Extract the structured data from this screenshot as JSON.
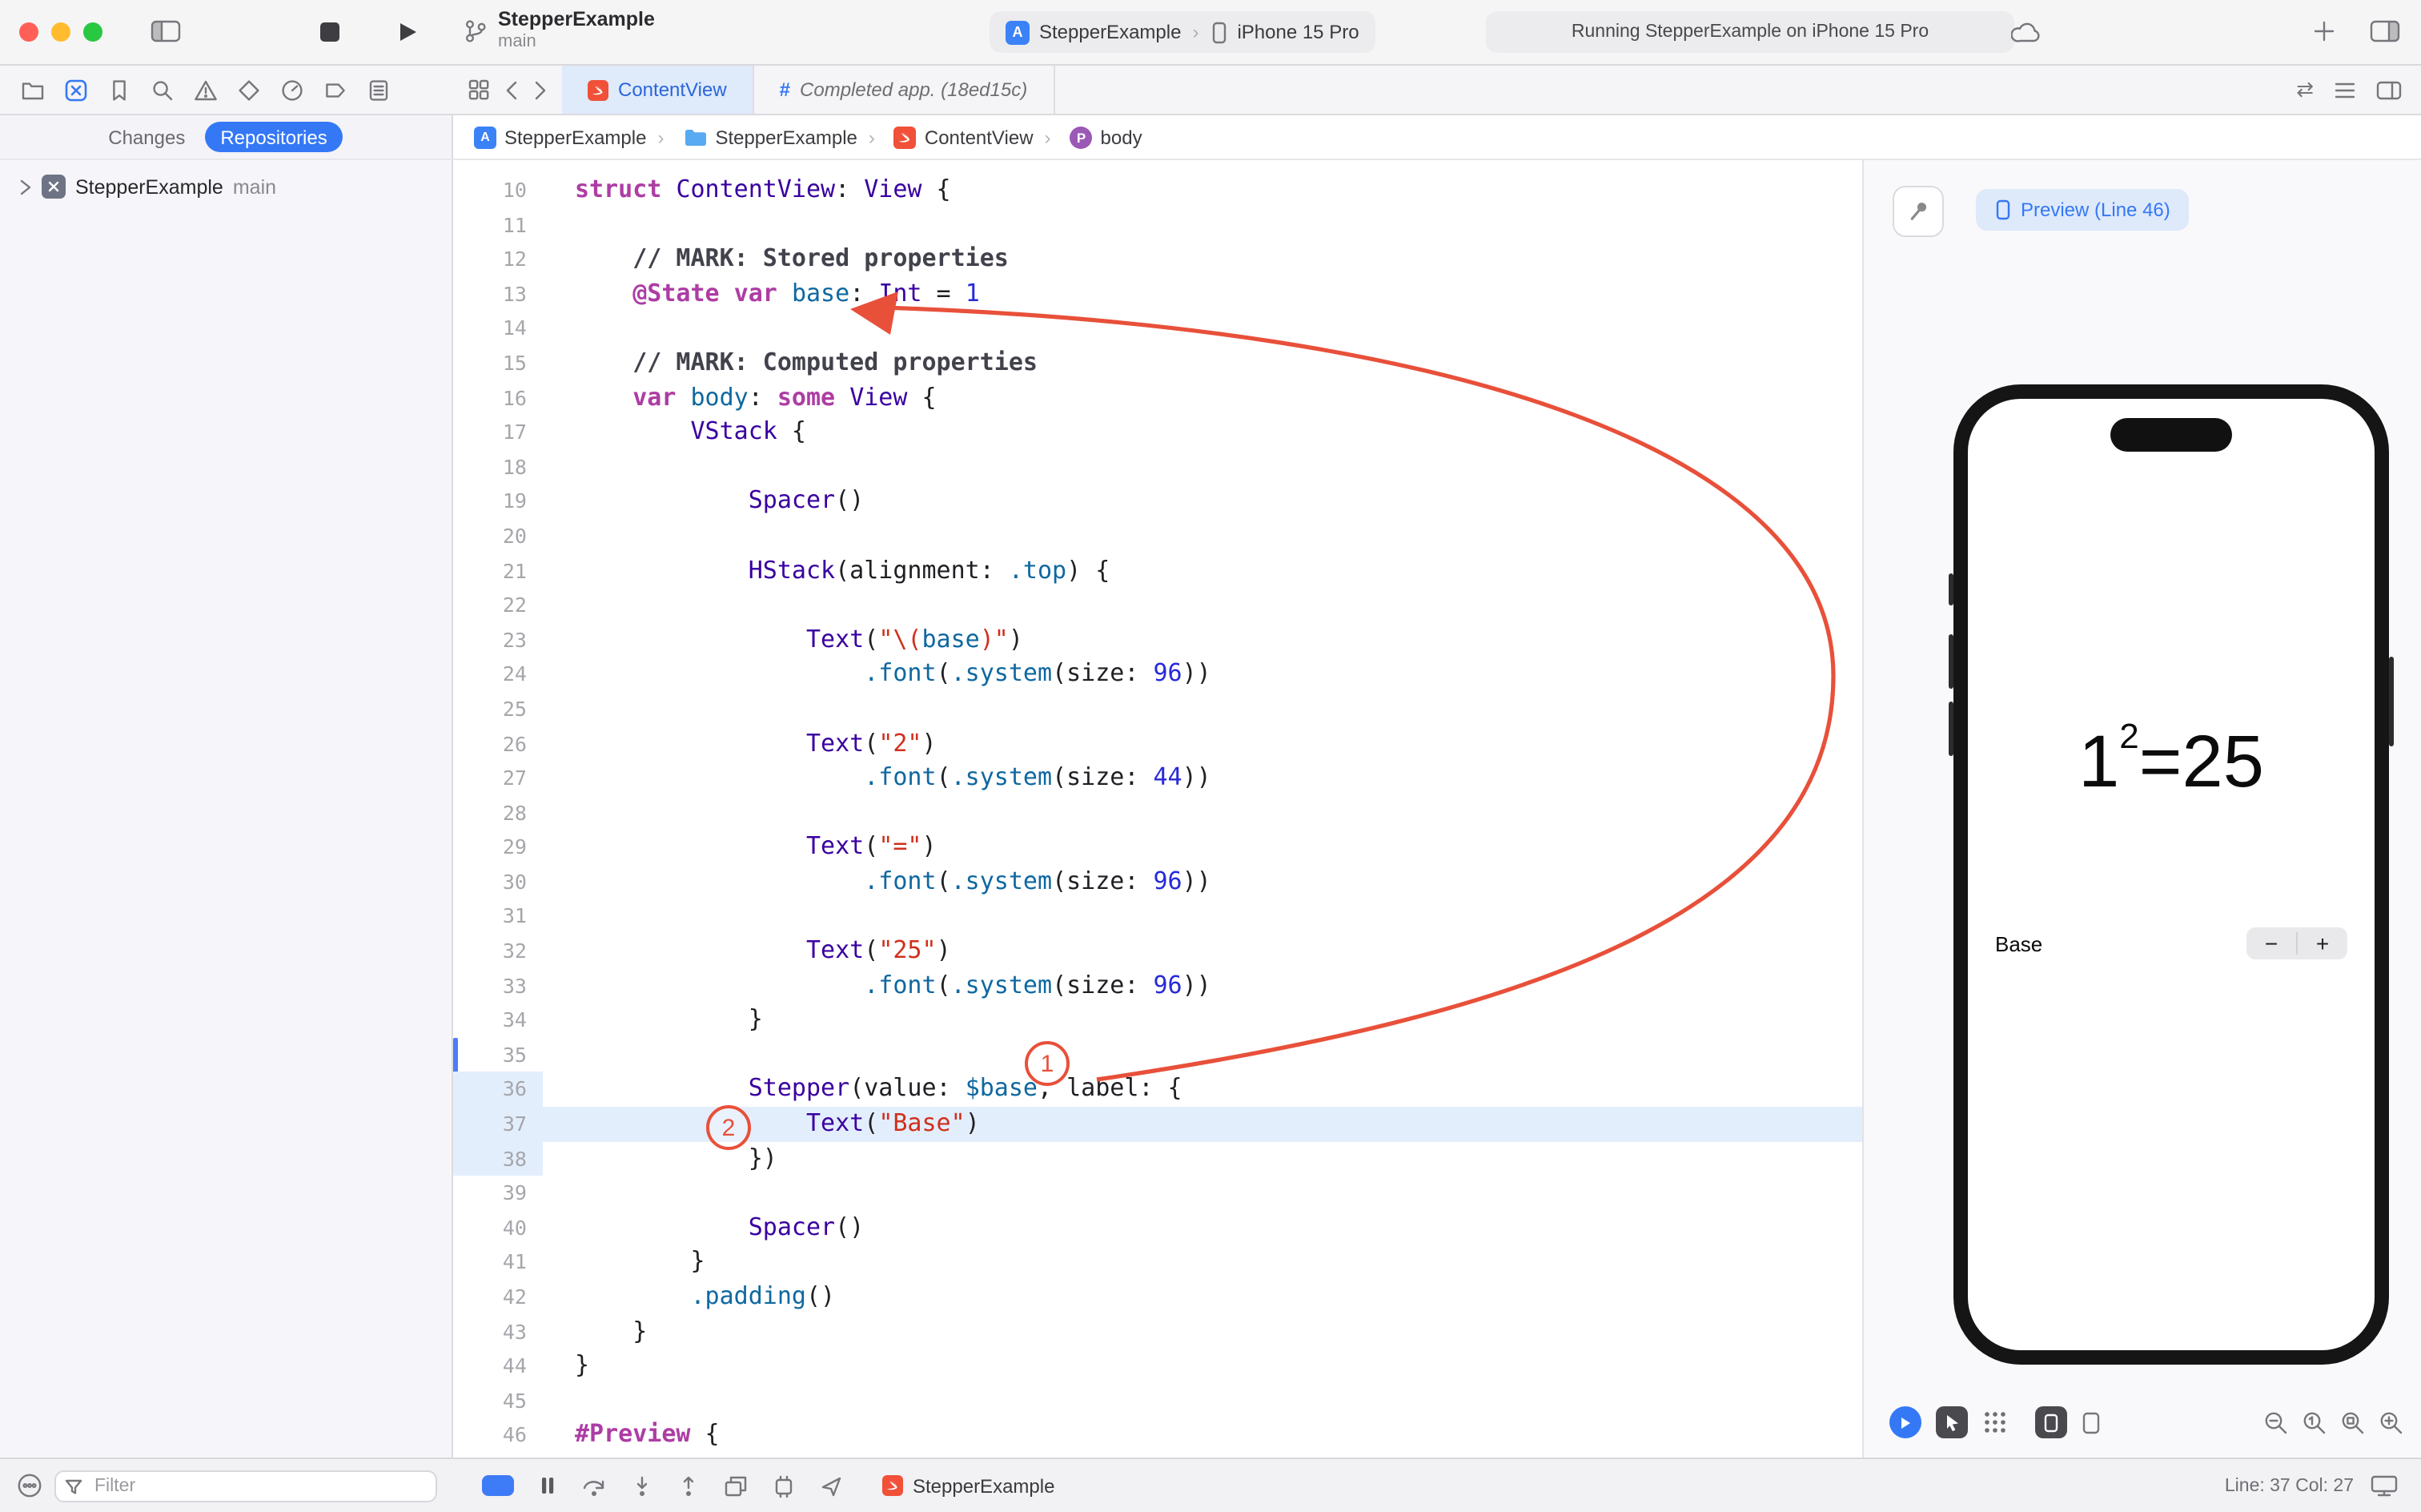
{
  "colors": {
    "accent": "#3478F6",
    "annotation_red": "#E8503A",
    "tab_active_bg": "#DFEAFB",
    "traffic_red": "#FF5F57",
    "traffic_yellow": "#FEBC2E",
    "traffic_green": "#28C840",
    "syntax_keyword": "#AD3DA4",
    "syntax_type": "#3900A0",
    "syntax_member": "#0F68A0",
    "syntax_string": "#D12F1B",
    "syntax_number": "#272AD8",
    "current_line_bg": "#E3EEFD",
    "change_bar": "#4D7DF7"
  },
  "titlebar": {
    "project": "StepperExample",
    "branch": "main",
    "scheme": "StepperExample",
    "device": "iPhone 15 Pro",
    "status": "Running StepperExample on iPhone 15 Pro"
  },
  "tabbar": {
    "tabs": [
      {
        "label": "ContentView",
        "active": true
      },
      {
        "prefix": "#",
        "label": "Completed app. (18ed15c)",
        "active": false
      }
    ]
  },
  "breadcrumb": {
    "items": [
      "StepperExample",
      "StepperExample",
      "ContentView",
      "body"
    ]
  },
  "sidebar": {
    "tabs": [
      "Changes",
      "Repositories"
    ],
    "active_tab": "Repositories",
    "items": [
      {
        "label": "StepperExample",
        "branch": "main"
      }
    ],
    "filter_placeholder": "Filter"
  },
  "editor": {
    "first_line": 10,
    "current_line": 37,
    "gutter_highlight": [
      36,
      37,
      38
    ],
    "changed_lines": [
      35,
      36,
      37,
      38
    ],
    "lines": [
      {
        "n": 10,
        "indent": 0,
        "tokens": [
          [
            "k",
            "struct"
          ],
          [
            "p",
            " "
          ],
          [
            "t",
            "ContentView"
          ],
          [
            "p",
            ": "
          ],
          [
            "t",
            "View"
          ],
          [
            "p",
            " {"
          ]
        ]
      },
      {
        "n": 11,
        "indent": 0,
        "tokens": []
      },
      {
        "n": 12,
        "indent": 4,
        "tokens": [
          [
            "c",
            "// MARK: Stored properties"
          ]
        ]
      },
      {
        "n": 13,
        "indent": 4,
        "tokens": [
          [
            "k",
            "@State"
          ],
          [
            "p",
            " "
          ],
          [
            "k",
            "var"
          ],
          [
            "p",
            " "
          ],
          [
            "m",
            "base"
          ],
          [
            "p",
            ": "
          ],
          [
            "t",
            "Int"
          ],
          [
            "p",
            " = "
          ],
          [
            "n",
            "1"
          ]
        ]
      },
      {
        "n": 14,
        "indent": 0,
        "tokens": []
      },
      {
        "n": 15,
        "indent": 4,
        "tokens": [
          [
            "c",
            "// MARK: Computed properties"
          ]
        ]
      },
      {
        "n": 16,
        "indent": 4,
        "tokens": [
          [
            "k",
            "var"
          ],
          [
            "p",
            " "
          ],
          [
            "m",
            "body"
          ],
          [
            "p",
            ": "
          ],
          [
            "k",
            "some"
          ],
          [
            "p",
            " "
          ],
          [
            "t",
            "View"
          ],
          [
            "p",
            " {"
          ]
        ]
      },
      {
        "n": 17,
        "indent": 8,
        "tokens": [
          [
            "t",
            "VStack"
          ],
          [
            "p",
            " {"
          ]
        ]
      },
      {
        "n": 18,
        "indent": 0,
        "tokens": []
      },
      {
        "n": 19,
        "indent": 12,
        "tokens": [
          [
            "t",
            "Spacer"
          ],
          [
            "p",
            "()"
          ]
        ]
      },
      {
        "n": 20,
        "indent": 0,
        "tokens": []
      },
      {
        "n": 21,
        "indent": 12,
        "tokens": [
          [
            "t",
            "HStack"
          ],
          [
            "p",
            "(alignment: "
          ],
          [
            "m",
            ".top"
          ],
          [
            "p",
            ") {"
          ]
        ]
      },
      {
        "n": 22,
        "indent": 0,
        "tokens": []
      },
      {
        "n": 23,
        "indent": 16,
        "tokens": [
          [
            "t",
            "Text"
          ],
          [
            "p",
            "("
          ],
          [
            "s",
            "\"\\("
          ],
          [
            "m",
            "base"
          ],
          [
            "s",
            ")\""
          ],
          [
            "p",
            ")"
          ]
        ]
      },
      {
        "n": 24,
        "indent": 20,
        "tokens": [
          [
            "m",
            ".font"
          ],
          [
            "p",
            "("
          ],
          [
            "m",
            ".system"
          ],
          [
            "p",
            "(size: "
          ],
          [
            "n",
            "96"
          ],
          [
            "p",
            "))"
          ]
        ]
      },
      {
        "n": 25,
        "indent": 0,
        "tokens": []
      },
      {
        "n": 26,
        "indent": 16,
        "tokens": [
          [
            "t",
            "Text"
          ],
          [
            "p",
            "("
          ],
          [
            "s",
            "\"2\""
          ],
          [
            "p",
            ")"
          ]
        ]
      },
      {
        "n": 27,
        "indent": 20,
        "tokens": [
          [
            "m",
            ".font"
          ],
          [
            "p",
            "("
          ],
          [
            "m",
            ".system"
          ],
          [
            "p",
            "(size: "
          ],
          [
            "n",
            "44"
          ],
          [
            "p",
            "))"
          ]
        ]
      },
      {
        "n": 28,
        "indent": 0,
        "tokens": []
      },
      {
        "n": 29,
        "indent": 16,
        "tokens": [
          [
            "t",
            "Text"
          ],
          [
            "p",
            "("
          ],
          [
            "s",
            "\"=\""
          ],
          [
            "p",
            ")"
          ]
        ]
      },
      {
        "n": 30,
        "indent": 20,
        "tokens": [
          [
            "m",
            ".font"
          ],
          [
            "p",
            "("
          ],
          [
            "m",
            ".system"
          ],
          [
            "p",
            "(size: "
          ],
          [
            "n",
            "96"
          ],
          [
            "p",
            "))"
          ]
        ]
      },
      {
        "n": 31,
        "indent": 0,
        "tokens": []
      },
      {
        "n": 32,
        "indent": 16,
        "tokens": [
          [
            "t",
            "Text"
          ],
          [
            "p",
            "("
          ],
          [
            "s",
            "\"25\""
          ],
          [
            "p",
            ")"
          ]
        ]
      },
      {
        "n": 33,
        "indent": 20,
        "tokens": [
          [
            "m",
            ".font"
          ],
          [
            "p",
            "("
          ],
          [
            "m",
            ".system"
          ],
          [
            "p",
            "(size: "
          ],
          [
            "n",
            "96"
          ],
          [
            "p",
            "))"
          ]
        ]
      },
      {
        "n": 34,
        "indent": 12,
        "tokens": [
          [
            "p",
            "}"
          ]
        ]
      },
      {
        "n": 35,
        "indent": 0,
        "tokens": []
      },
      {
        "n": 36,
        "indent": 12,
        "tokens": [
          [
            "t",
            "Stepper"
          ],
          [
            "p",
            "(value: "
          ],
          [
            "m",
            "$base"
          ],
          [
            "p",
            ", label: {"
          ]
        ]
      },
      {
        "n": 37,
        "indent": 16,
        "tokens": [
          [
            "t",
            "Text"
          ],
          [
            "p",
            "("
          ],
          [
            "s",
            "\"Base\""
          ],
          [
            "p",
            ")"
          ]
        ]
      },
      {
        "n": 38,
        "indent": 12,
        "tokens": [
          [
            "p",
            "})"
          ]
        ]
      },
      {
        "n": 39,
        "indent": 0,
        "tokens": []
      },
      {
        "n": 40,
        "indent": 12,
        "tokens": [
          [
            "t",
            "Spacer"
          ],
          [
            "p",
            "()"
          ]
        ]
      },
      {
        "n": 41,
        "indent": 8,
        "tokens": [
          [
            "p",
            "}"
          ]
        ]
      },
      {
        "n": 42,
        "indent": 8,
        "tokens": [
          [
            "m",
            ".padding"
          ],
          [
            "p",
            "()"
          ]
        ]
      },
      {
        "n": 43,
        "indent": 4,
        "tokens": [
          [
            "p",
            "}"
          ]
        ]
      },
      {
        "n": 44,
        "indent": 0,
        "tokens": [
          [
            "p",
            "}"
          ]
        ]
      },
      {
        "n": 45,
        "indent": 0,
        "tokens": []
      },
      {
        "n": 46,
        "indent": 0,
        "tokens": [
          [
            "k",
            "#Preview"
          ],
          [
            "p",
            " {"
          ]
        ]
      }
    ]
  },
  "annotations": {
    "badge_one": "1",
    "badge_two": "2"
  },
  "canvas": {
    "preview_label": "Preview (Line 46)",
    "phone": {
      "eq_base": "1",
      "eq_exp": "2",
      "eq_equals": "=",
      "eq_result": "25",
      "stepper_label": "Base",
      "minus": "−",
      "plus": "+"
    }
  },
  "statusbar": {
    "app": "StepperExample",
    "line_col": "Line: 37  Col: 27"
  }
}
